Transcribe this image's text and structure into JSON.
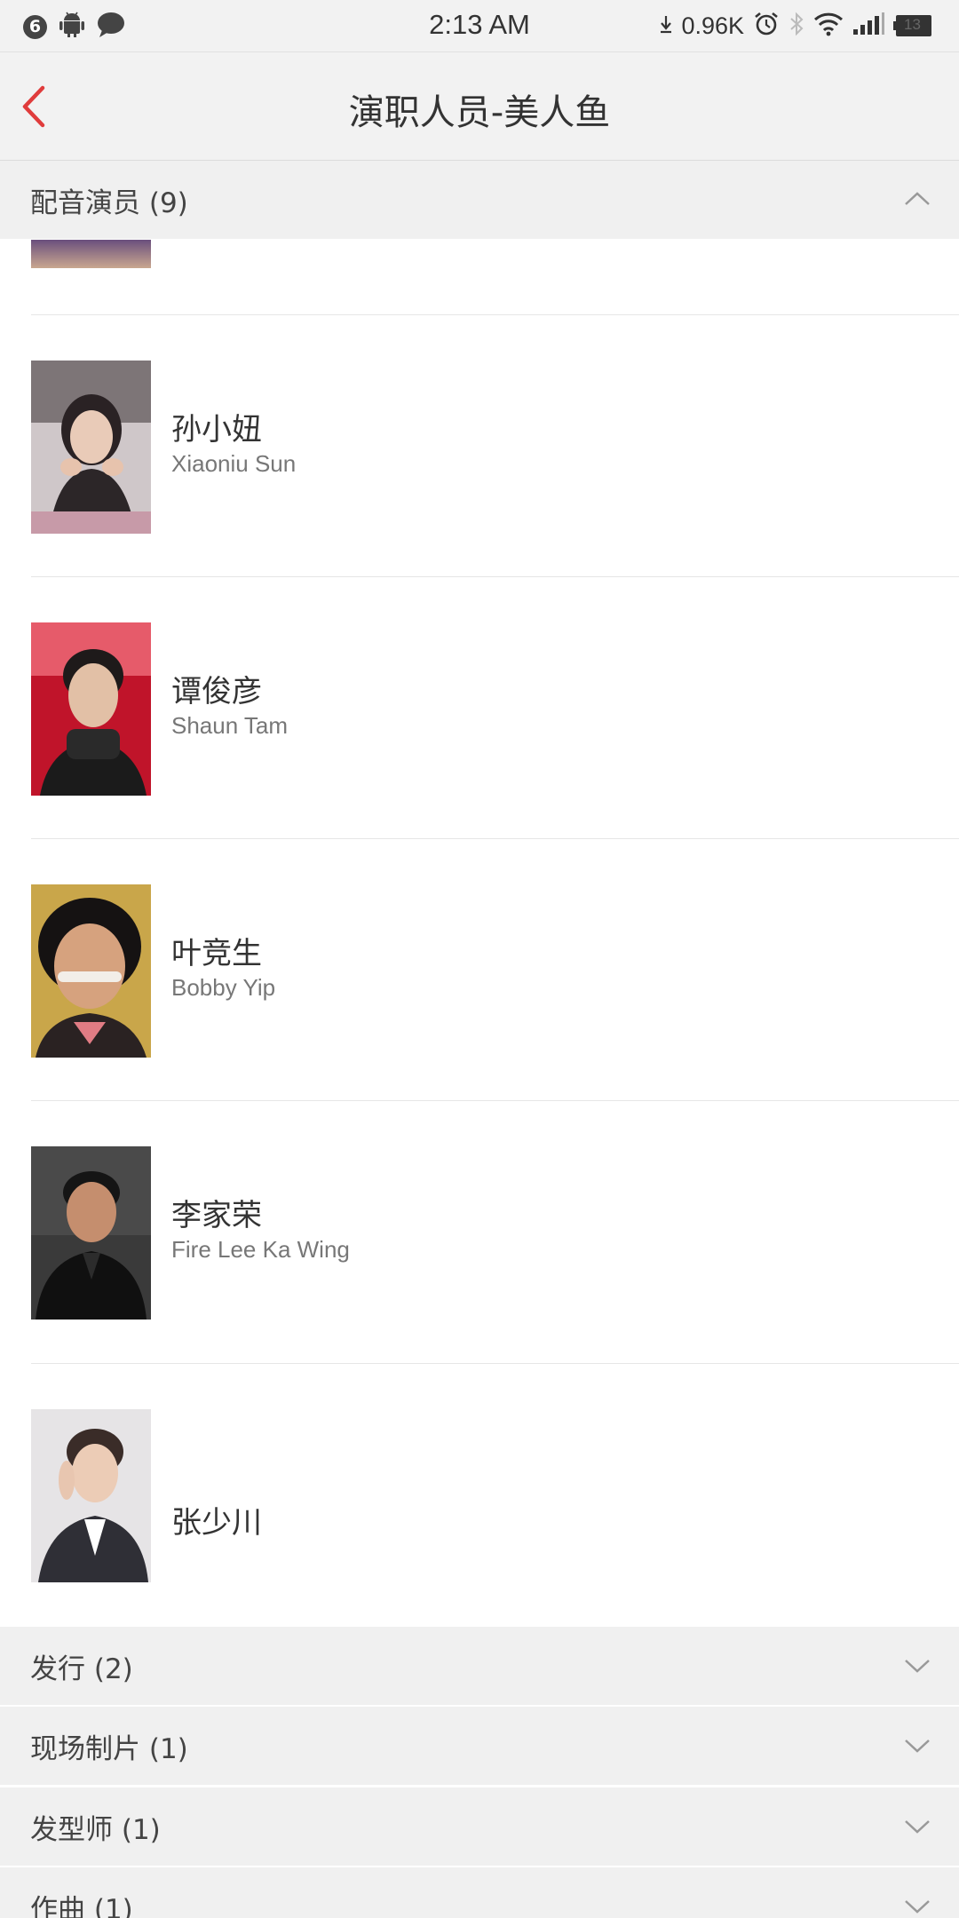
{
  "status_bar": {
    "notification_count": "6",
    "time": "2:13 AM",
    "net_speed": "0.96K",
    "battery": "13"
  },
  "header": {
    "title": "演职人员-美人鱼"
  },
  "sections": {
    "voice_actors": {
      "label": "配音演员 (9)"
    },
    "distribution": {
      "label": "发行 (2)"
    },
    "production_manager": {
      "label": "现场制片 (1)"
    },
    "hair_stylist": {
      "label": "发型师 (1)"
    },
    "composer": {
      "label": "作曲 (1)"
    }
  },
  "cast": [
    {
      "name_cn": "孙小妞",
      "name_en": "Xiaoniu Sun"
    },
    {
      "name_cn": "谭俊彦",
      "name_en": "Shaun Tam"
    },
    {
      "name_cn": "叶竞生",
      "name_en": "Bobby Yip"
    },
    {
      "name_cn": "李家荣",
      "name_en": "Fire Lee Ka Wing"
    },
    {
      "name_cn": "张少川",
      "name_en": ""
    }
  ],
  "colors": {
    "accent": "#e03c3c",
    "header_bg": "#f2f2f2",
    "section_bg": "#f0f0f0"
  }
}
